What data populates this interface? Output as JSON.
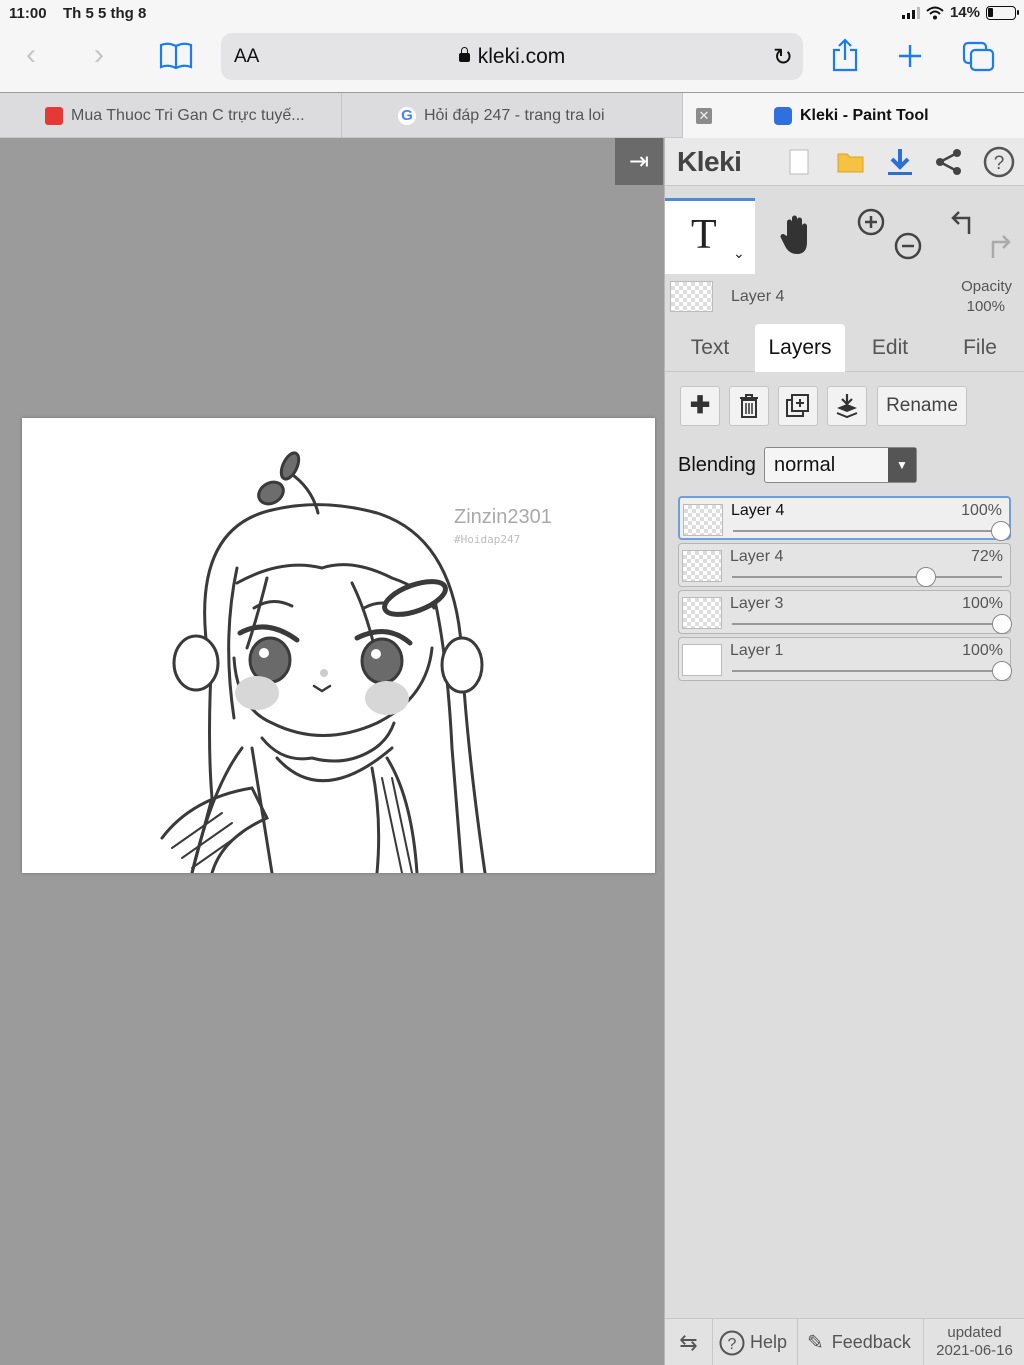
{
  "status_bar": {
    "time": "11:00",
    "date": "Th 5 5 thg 8",
    "battery": "14%"
  },
  "browser": {
    "text_size_label": "AA",
    "url": "kleki.com",
    "tabs": [
      {
        "label": "Mua Thuoc Tri Gan C trực tuyế..."
      },
      {
        "label": "Hỏi đáp 247 - trang tra loi"
      },
      {
        "label": "Kleki - Paint Tool"
      }
    ]
  },
  "canvas": {
    "watermark": "Zinzin2301",
    "watermark_sub": "#Hoidap247"
  },
  "app": {
    "logo": "Kleki",
    "current_layer": {
      "name": "Layer 4",
      "opacity_label": "Opacity",
      "opacity_value": "100%"
    },
    "panel_tabs": [
      "Text",
      "Layers",
      "Edit",
      "File"
    ],
    "active_panel_tab": "Layers",
    "rename_label": "Rename",
    "blending_label": "Blending",
    "blending_value": "normal",
    "layers": [
      {
        "name": "Layer 4",
        "opacity": "100%",
        "value": 1.0,
        "selected": true
      },
      {
        "name": "Layer 4",
        "opacity": "72%",
        "value": 0.72,
        "selected": false
      },
      {
        "name": "Layer 3",
        "opacity": "100%",
        "value": 1.0,
        "selected": false
      },
      {
        "name": "Layer 1",
        "opacity": "100%",
        "value": 1.0,
        "selected": false
      }
    ],
    "footer": {
      "help": "Help",
      "feedback": "Feedback",
      "updated_label": "updated",
      "updated_date": "2021-06-16"
    }
  }
}
